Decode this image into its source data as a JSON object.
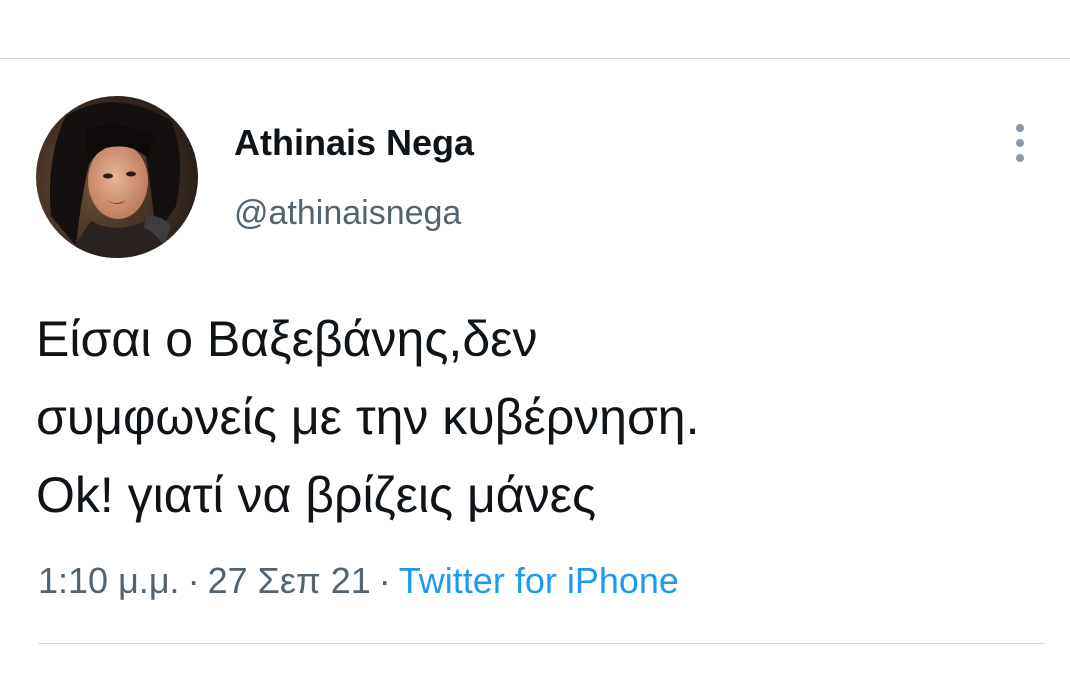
{
  "tweet": {
    "author": {
      "display_name": "Athinais Nega",
      "handle": "@athinaisnega"
    },
    "text_lines": [
      "Είσαι ο Βαξεβάνης,δεν",
      "συμφωνείς με την κυβέρνηση.",
      "Ok! γιατί να βρίζεις μάνες"
    ],
    "meta": {
      "time": "1:10 μ.μ.",
      "separator": "·",
      "date": "27 Σεπ 21",
      "source": "Twitter for iPhone"
    }
  },
  "icons": {
    "more": "more-vertical-icon",
    "avatar": "profile-photo"
  },
  "colors": {
    "text_primary": "#0f1419",
    "text_secondary": "#536471",
    "link": "#1d9bf0",
    "divider": "#cfd9de"
  }
}
